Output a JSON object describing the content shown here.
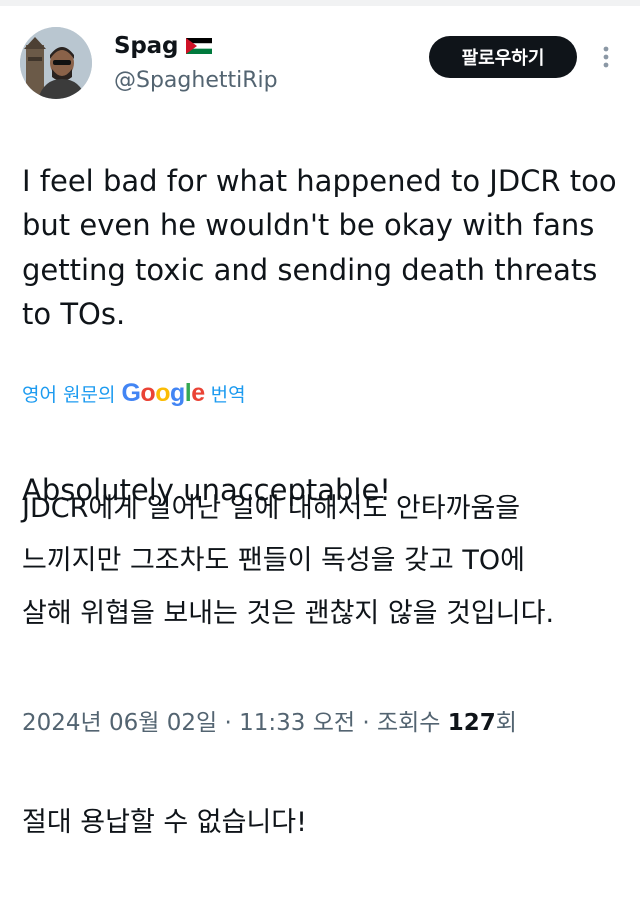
{
  "user": {
    "display_name": "Spag",
    "handle": "@SpaghettiRip"
  },
  "actions": {
    "follow_label": "팔로우하기"
  },
  "tweet": {
    "paragraph_1": "I feel bad for what happened to JDCR too but even he wouldn't be okay with fans getting toxic and sending death threats to TOs.",
    "paragraph_2": "Absolutely unacceptable!"
  },
  "translation": {
    "prefix": "영어 원문의",
    "provider": "Google",
    "suffix": "번역",
    "paragraph_1": "JDCR에게 일어난 일에 대해서도 안타까움을\n느끼지만 그조차도 팬들이 독성을 갖고 TO에\n살해 위협을 보내는 것은 괜찮지 않을 것입니다.",
    "paragraph_2": "절대 용납할 수 없습니다!"
  },
  "meta": {
    "date": "2024년 06월 02일",
    "separator": "·",
    "time": "11:33 오전",
    "views_label": "조회수",
    "views_count": "127",
    "views_unit": "회"
  },
  "colors": {
    "link": "#1d9bf0",
    "text": "#0f1419",
    "muted": "#536471",
    "button_bg": "#0f1419"
  },
  "icons": {
    "more": "more-vertical-icon",
    "flag": "palestine-flag-icon"
  }
}
